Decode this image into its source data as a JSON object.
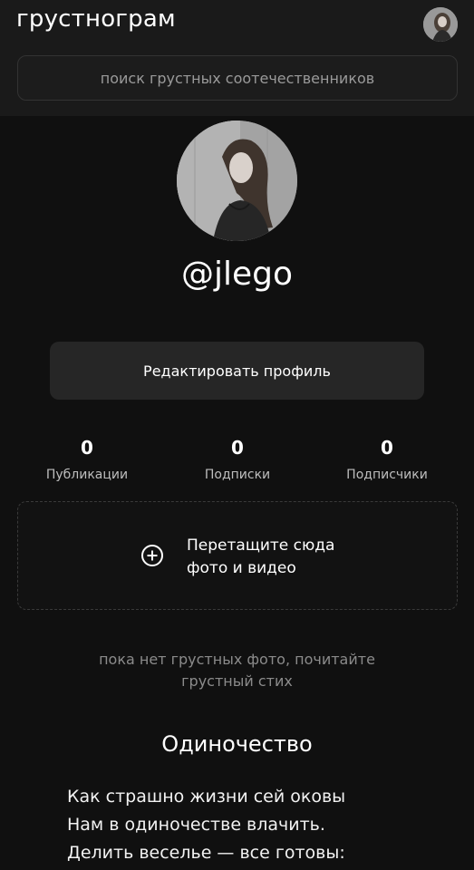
{
  "header": {
    "app_title": "грустнограм",
    "search_placeholder": "поиск грустных соотечественников"
  },
  "profile": {
    "username": "@jlego",
    "edit_button_label": "Редактировать профиль"
  },
  "stats": [
    {
      "value": "0",
      "label": "Публикации"
    },
    {
      "value": "0",
      "label": "Подписки"
    },
    {
      "value": "0",
      "label": "Подписчики"
    }
  ],
  "dropzone": {
    "icon": "plus-circle-icon",
    "line1": "Перетащите сюда",
    "line2": "фото и видео"
  },
  "empty_state": {
    "line1": "пока нет грустных фото, почитайте",
    "line2": "грустный стих"
  },
  "poem": {
    "title": "Одиночество",
    "lines": [
      "Как страшно жизни сей оковы",
      "Нам в одиночестве влачить.",
      "Делить веселье — все готовы:"
    ]
  }
}
